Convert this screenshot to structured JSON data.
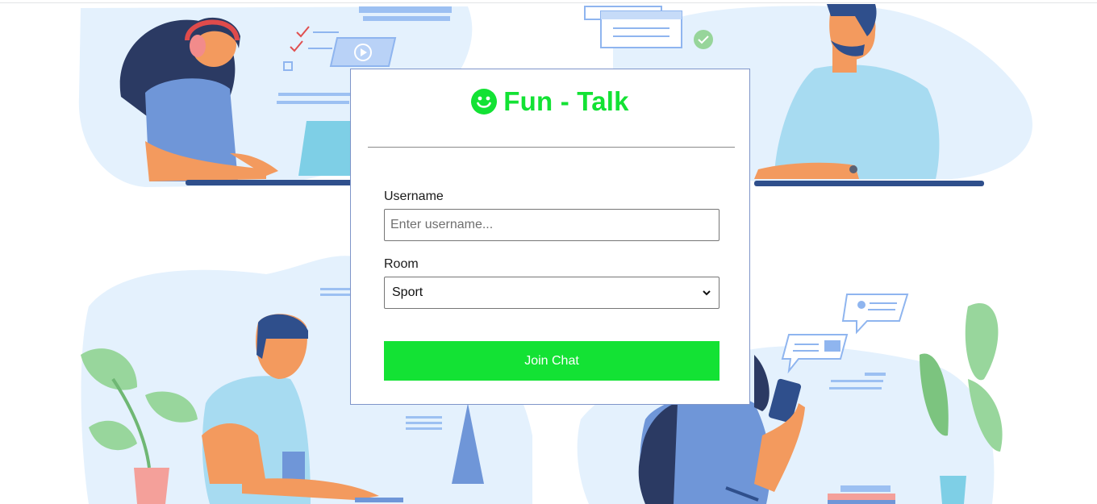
{
  "app": {
    "title": "Fun - Talk"
  },
  "form": {
    "username_label": "Username",
    "username_placeholder": "Enter username...",
    "username_value": "",
    "room_label": "Room",
    "room_selected": "Sport",
    "submit_label": "Join Chat"
  },
  "colors": {
    "brand_green": "#13e234",
    "illustration_blue": "#e4f1fd",
    "card_border": "#7f95c9"
  },
  "icons": [
    "smiley-icon",
    "chevron-down-icon"
  ]
}
